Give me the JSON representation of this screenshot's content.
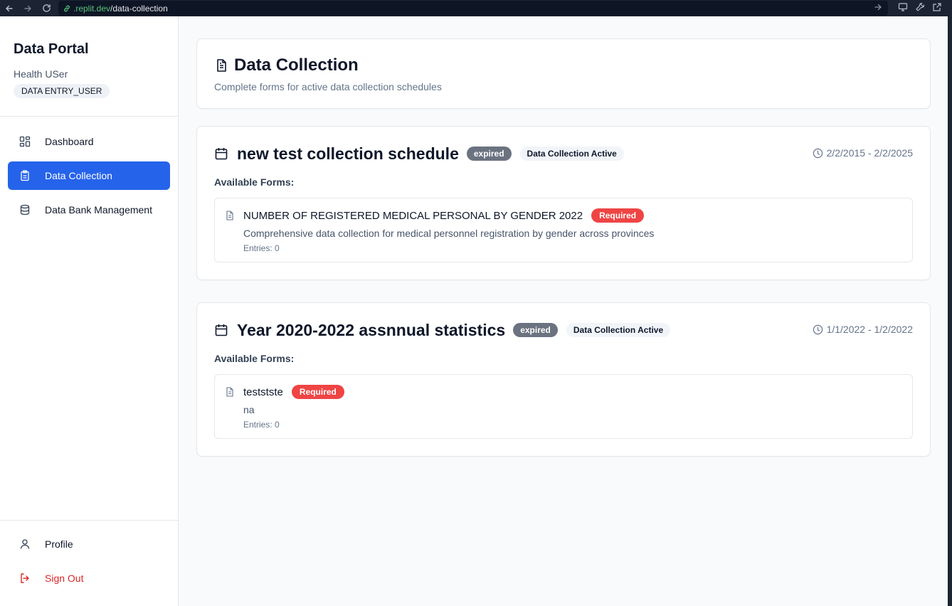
{
  "browser": {
    "url_host": ".replit.dev",
    "url_path": "/data-collection"
  },
  "sidebar": {
    "app_title": "Data Portal",
    "user_name": "Health USer",
    "role": "DATA ENTRY_USER",
    "items": [
      {
        "label": "Dashboard",
        "icon": "dashboard-icon"
      },
      {
        "label": "Data Collection",
        "icon": "clipboard-icon",
        "active": true
      },
      {
        "label": "Data Bank Management",
        "icon": "database-icon"
      }
    ],
    "bottom_items": [
      {
        "label": "Profile",
        "icon": "user-icon"
      },
      {
        "label": "Sign Out",
        "icon": "sign-out-icon"
      }
    ]
  },
  "header": {
    "title": "Data Collection",
    "subtitle": "Complete forms for active data collection schedules"
  },
  "available_forms_label": "Available Forms:",
  "schedules": [
    {
      "title": "new test collection schedule",
      "status": "expired",
      "collection_status": "Data Collection Active",
      "date_range": "2/2/2015 - 2/2/2025",
      "forms": [
        {
          "title": "NUMBER OF REGISTERED MEDICAL PERSONAL BY GENDER 2022",
          "badge": "Required",
          "description": "Comprehensive data collection for medical personnel registration by gender across provinces",
          "entries": "Entries: 0"
        }
      ]
    },
    {
      "title": "Year 2020-2022 assnnual statistics",
      "status": "expired",
      "collection_status": "Data Collection Active",
      "date_range": "1/1/2022 - 1/2/2022",
      "forms": [
        {
          "title": "teststste",
          "badge": "Required",
          "description": "na",
          "entries": "Entries: 0"
        }
      ]
    }
  ],
  "colors": {
    "primary": "#2563eb",
    "required": "#ef4444",
    "expired": "#6b7280",
    "signout": "#dc2626"
  }
}
